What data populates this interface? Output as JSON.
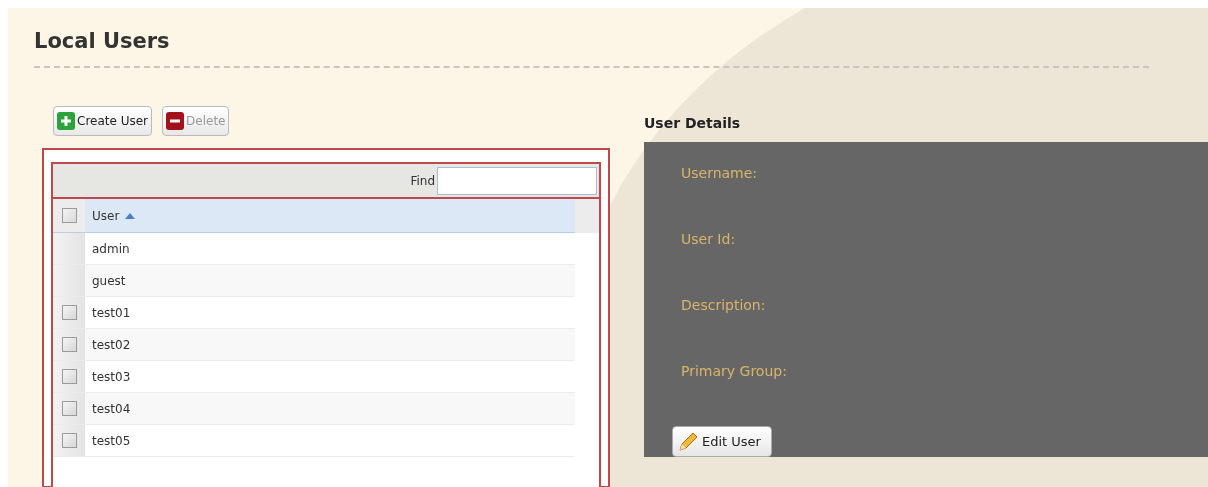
{
  "title": "Local Users",
  "toolbar": [
    {
      "label": "Create User",
      "kind": "add",
      "disabled": false
    },
    {
      "label": "Delete",
      "kind": "delete",
      "disabled": true
    }
  ],
  "grid": {
    "find_label": "Find",
    "header": {
      "label": "User",
      "checked": false,
      "sorted_ascending": true
    },
    "rows": [
      {
        "user": "admin",
        "kind": "fixed"
      },
      {
        "user": "guest",
        "kind": "fixed"
      },
      {
        "user": "test01",
        "kind": "checkbox",
        "checked": false
      },
      {
        "user": "test02",
        "kind": "checkbox",
        "checked": false
      },
      {
        "user": "test03",
        "kind": "checkbox",
        "checked": false
      },
      {
        "user": "test04",
        "kind": "checkbox",
        "checked": false
      },
      {
        "user": "test05",
        "kind": "checkbox",
        "checked": false
      }
    ]
  },
  "details": {
    "title": "User Details",
    "fields": [
      "Username:",
      "User Id:",
      "Description:",
      "Primary Group:"
    ],
    "edit_button": "Edit User"
  }
}
